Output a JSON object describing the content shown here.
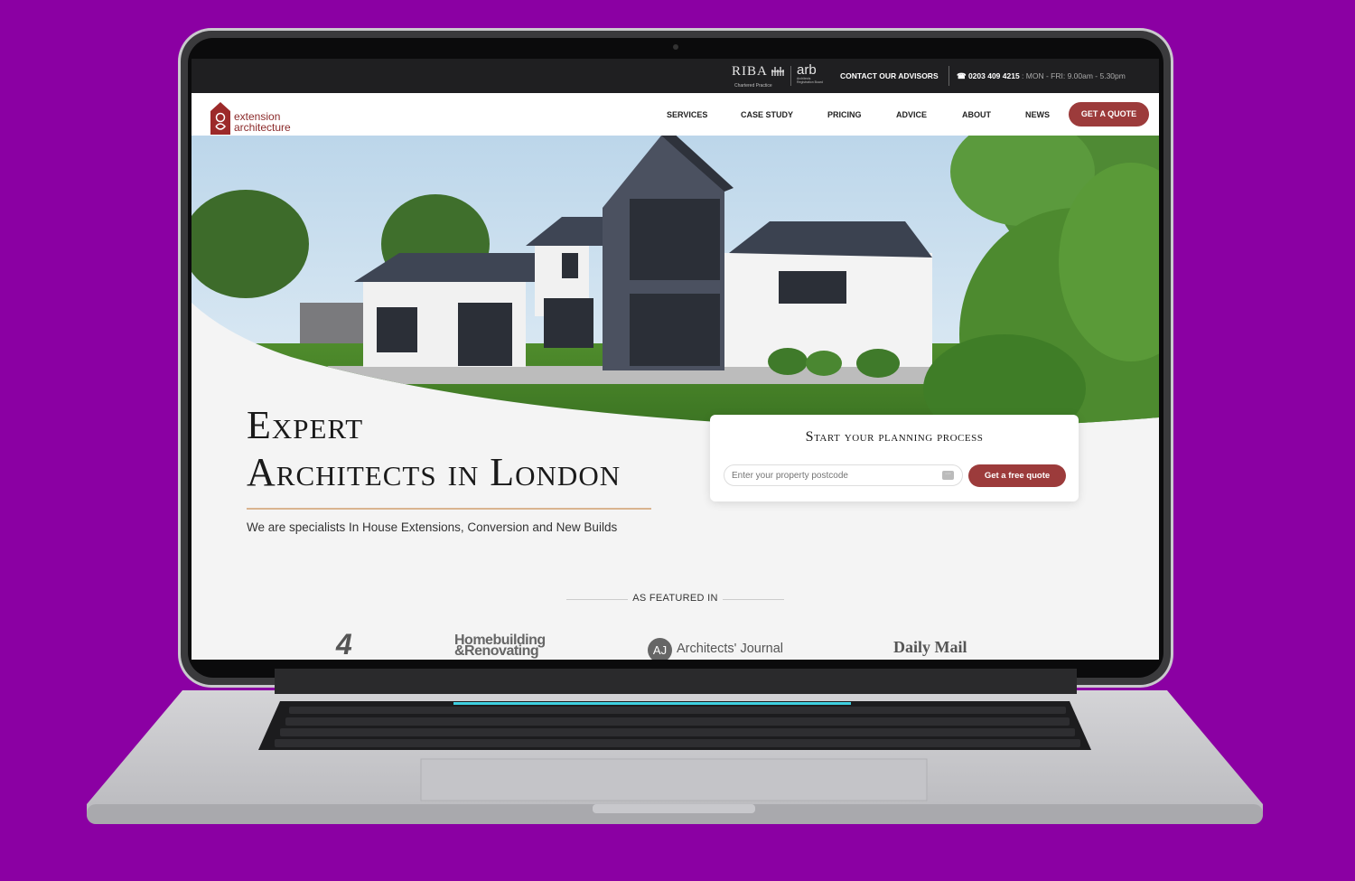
{
  "topbar": {
    "riba": "RIBA",
    "riba_sub": "Chartered Practice",
    "arb": "arb",
    "arb_sub": "Architects Registration Board",
    "contact": "CONTACT OUR ADVISORS",
    "phone": "☎ 0203 409 4215",
    "hours": " : MON - FRI: 9.00am - 5.30pm"
  },
  "logo": {
    "line1": "extension",
    "line2": "architecture"
  },
  "nav": {
    "items": [
      "SERVICES",
      "CASE STUDY",
      "PRICING",
      "ADVICE",
      "ABOUT",
      "NEWS"
    ],
    "cta": "GET A QUOTE"
  },
  "hero": {
    "title_line1": "Expert",
    "title_line2": "Architects in London",
    "subtitle": "We are specialists In House Extensions, Conversion and New Builds"
  },
  "planning_card": {
    "title": "Start your planning process",
    "postcode_placeholder": "Enter your property postcode",
    "button": "Get a free quote"
  },
  "featured": {
    "label": "AS FEATURED IN",
    "channel4": "4",
    "homebuilding_line1": "Homebuilding",
    "homebuilding_line2": "&Renovating",
    "aj_badge": "AJ",
    "aj_name": "Architects' Journal",
    "dailymail": "Daily Mail"
  },
  "colors": {
    "background": "#8b00a3",
    "brand_red": "#9c3b3b",
    "accent_gold": "#d9b48f"
  }
}
